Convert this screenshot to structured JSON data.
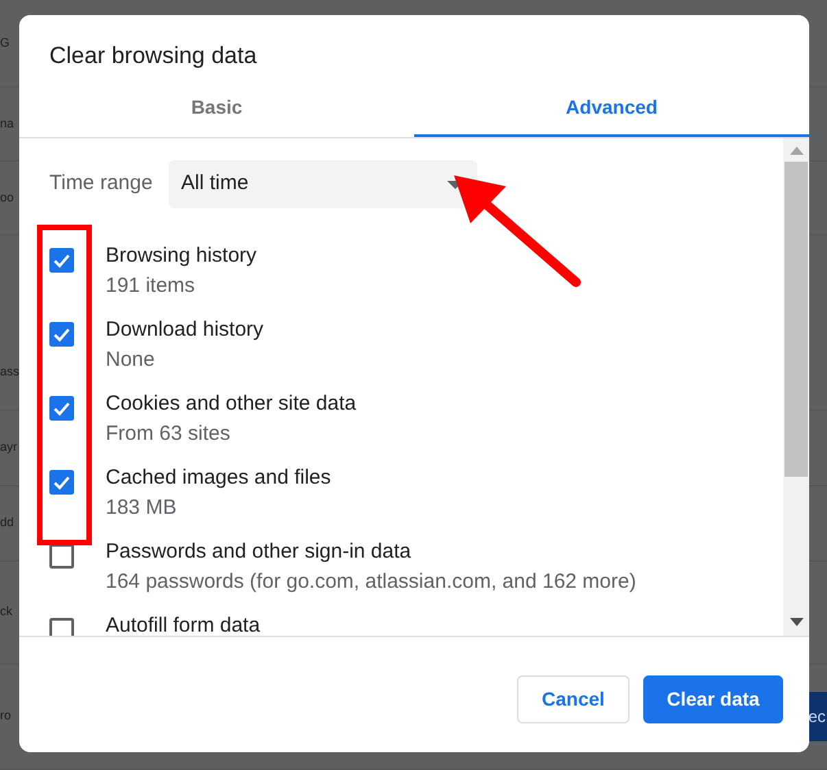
{
  "background_page": {
    "left_fragments": [
      "G",
      "na",
      "oo",
      "ass",
      "ayr",
      "dd",
      "ck",
      "ro"
    ],
    "right_fragment": "ec"
  },
  "dialog": {
    "title": "Clear browsing data",
    "tabs": [
      {
        "label": "Basic",
        "selected": false
      },
      {
        "label": "Advanced",
        "selected": true
      }
    ],
    "time_range": {
      "label": "Time range",
      "value": "All time"
    },
    "items": [
      {
        "title": "Browsing history",
        "detail": "191 items",
        "checked": true
      },
      {
        "title": "Download history",
        "detail": "None",
        "checked": true
      },
      {
        "title": "Cookies and other site data",
        "detail": "From 63 sites",
        "checked": true
      },
      {
        "title": "Cached images and files",
        "detail": "183 MB",
        "checked": true
      },
      {
        "title": "Passwords and other sign-in data",
        "detail": "164 passwords (for go.com, atlassian.com, and 162 more)",
        "checked": false
      },
      {
        "title": "Autofill form data",
        "checked": false
      }
    ],
    "buttons": [
      {
        "label": "Cancel",
        "kind": "secondary"
      },
      {
        "label": "Clear data",
        "kind": "primary"
      }
    ]
  },
  "annotations": {
    "highlight_box": true,
    "arrow": true
  }
}
